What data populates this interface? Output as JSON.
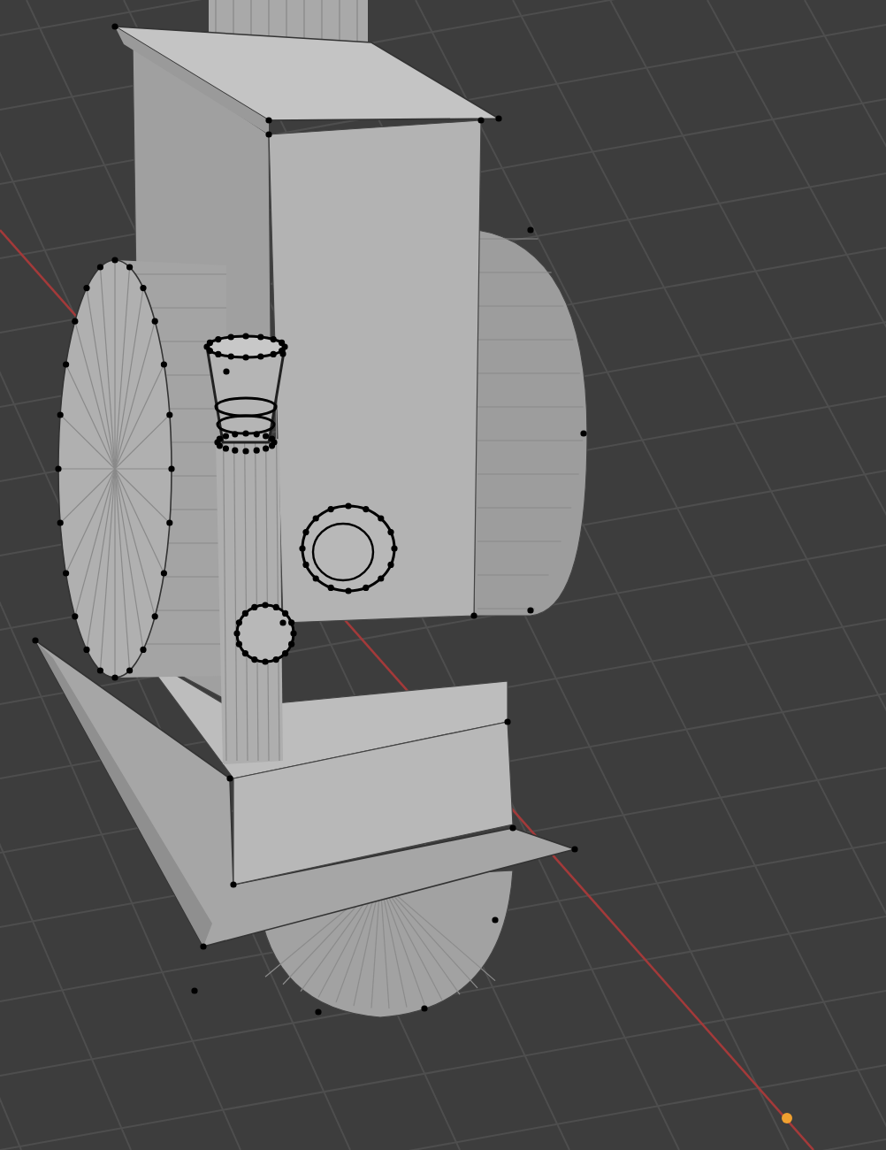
{
  "viewport": {
    "kind": "mesh"
  }
}
